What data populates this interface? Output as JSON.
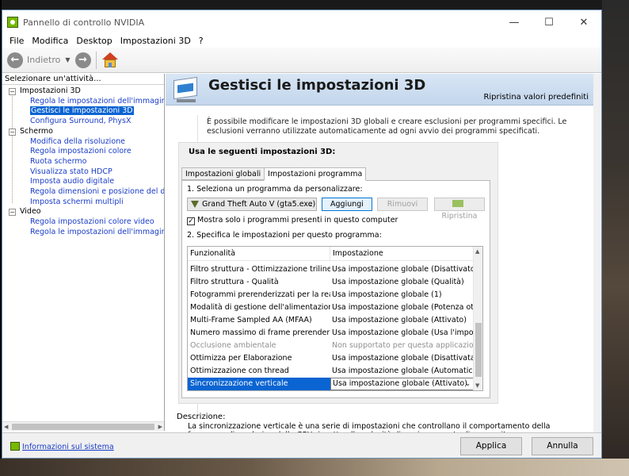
{
  "window": {
    "title": "Pannello di controllo NVIDIA"
  },
  "menu": [
    "File",
    "Modifica",
    "Desktop",
    "Impostazioni 3D",
    "?"
  ],
  "toolbar": {
    "back_label": "Indietro"
  },
  "left_panel": {
    "header": "Selezionare un'attività...",
    "groups": [
      {
        "label": "Impostazioni 3D",
        "items": [
          {
            "label": "Regola le impostazioni dell'immagine con an",
            "selected": false
          },
          {
            "label": "Gestisci le impostazioni 3D",
            "selected": true
          },
          {
            "label": "Configura Surround, PhysX",
            "selected": false
          }
        ]
      },
      {
        "label": "Schermo",
        "items": [
          {
            "label": "Modifica della risoluzione"
          },
          {
            "label": "Regola impostazioni colore"
          },
          {
            "label": "Ruota schermo"
          },
          {
            "label": "Visualizza stato HDCP"
          },
          {
            "label": "Imposta audio digitale"
          },
          {
            "label": "Regola dimensioni e posizione del desktop"
          },
          {
            "label": "Imposta schermi multipli"
          }
        ]
      },
      {
        "label": "Video",
        "items": [
          {
            "label": "Regola impostazioni colore video"
          },
          {
            "label": "Regola le impostazioni dell'immagine video"
          }
        ]
      }
    ]
  },
  "main": {
    "title": "Gestisci le impostazioni 3D",
    "restore_defaults": "Ripristina valori predefiniti",
    "intro": "È possibile modificare le impostazioni 3D globali e creare esclusioni per programmi specifici. Le esclusioni verranno utilizzate automaticamente ad ogni avvio dei programmi specificati.",
    "group_title": "Usa le seguenti impostazioni 3D:",
    "tabs": [
      {
        "label": "Impostazioni globali",
        "active": false
      },
      {
        "label": "Impostazioni programma",
        "active": true
      }
    ],
    "step1": "1. Seleziona un programma da personalizzare:",
    "program_selected": "Grand Theft Auto V (gta5.exe)",
    "buttons": {
      "add": "Aggiungi",
      "remove": "Rimuovi",
      "restore": "Ripristina"
    },
    "checkbox_label": "Mostra solo i programmi presenti in questo computer",
    "checkbox_checked": true,
    "step2": "2. Specifica le impostazioni per questo programma:",
    "grid": {
      "headers": [
        "Funzionalità",
        "Impostazione"
      ],
      "rows": [
        {
          "feature": "Filtro struttura - Ottimizzazione trilineare",
          "setting": "Usa impostazione globale (Disattivato)"
        },
        {
          "feature": "Filtro struttura - Qualità",
          "setting": "Usa impostazione globale (Qualità)"
        },
        {
          "feature": "Fotogrammi prerenderizzati per la realtà vi...",
          "setting": "Usa impostazione globale (1)"
        },
        {
          "feature": "Modalità di gestione dell'alimentazione",
          "setting": "Usa impostazione globale (Potenza ottimale)"
        },
        {
          "feature": "Multi-Frame Sampled AA (MFAA)",
          "setting": "Usa impostazione globale (Attivato)"
        },
        {
          "feature": "Numero massimo di frame prerenderizzati",
          "setting": "Usa impostazione globale (Usa l'impostazio..."
        },
        {
          "feature": "Occlusione ambientale",
          "setting": "Non supportato per questa applicazione",
          "disabled": true
        },
        {
          "feature": "Ottimizza per Elaborazione",
          "setting": "Usa impostazione globale (Disattivata)"
        },
        {
          "feature": "Ottimizzazione con thread",
          "setting": "Usa impostazione globale (Automatico)"
        },
        {
          "feature": "Sincronizzazione verticale",
          "setting": "Usa impostazione globale (Attivato)",
          "selected": true
        }
      ]
    },
    "description_label": "Descrizione:",
    "description_text": "La sincronizzazione verticale è una serie di impostazioni che controllano il comportamento della frequenza di rendering della GPU rispetto alla velocità di aggiornamento di un monitor."
  },
  "footer": {
    "system_info": "Informazioni sul sistema",
    "apply": "Applica",
    "cancel": "Annulla"
  },
  "colors": {
    "selection": "#0a64d2",
    "link": "#1a3cc8",
    "banner": "#c3d6ec",
    "nvidia_green": "#76b900"
  }
}
